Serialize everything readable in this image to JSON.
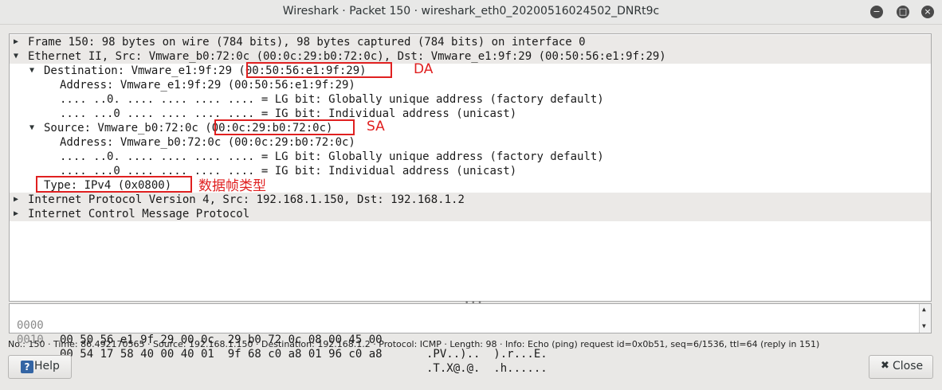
{
  "window": {
    "title": "Wireshark · Packet 150 · wireshark_eth0_20200516024502_DNRt9c",
    "minimize_glyph": "−",
    "maximize_glyph": "□",
    "close_glyph": "×"
  },
  "tree": {
    "rows": [
      {
        "arrow": "▶",
        "text": "Frame 150: 98 bytes on wire (784 bits), 98 bytes captured (784 bits) on interface 0"
      },
      {
        "arrow": "▼",
        "text": "Ethernet II, Src: Vmware_b0:72:0c (00:0c:29:b0:72:0c), Dst: Vmware_e1:9f:29 (00:50:56:e1:9f:29)"
      },
      {
        "arrow": "▼",
        "text": "Destination: Vmware_e1:9f:29 (00:50:56:e1:9f:29)"
      },
      {
        "arrow": "",
        "text": "Address: Vmware_e1:9f:29 (00:50:56:e1:9f:29)"
      },
      {
        "arrow": "",
        "text": ".... ..0. .... .... .... .... = LG bit: Globally unique address (factory default)"
      },
      {
        "arrow": "",
        "text": ".... ...0 .... .... .... .... = IG bit: Individual address (unicast)"
      },
      {
        "arrow": "▼",
        "text": "Source: Vmware_b0:72:0c (00:0c:29:b0:72:0c)"
      },
      {
        "arrow": "",
        "text": "Address: Vmware_b0:72:0c (00:0c:29:b0:72:0c)"
      },
      {
        "arrow": "",
        "text": ".... ..0. .... .... .... .... = LG bit: Globally unique address (factory default)"
      },
      {
        "arrow": "",
        "text": ".... ...0 .... .... .... .... = IG bit: Individual address (unicast)"
      },
      {
        "arrow": "",
        "text": "Type: IPv4 (0x0800)"
      },
      {
        "arrow": "▶",
        "text": "Internet Protocol Version 4, Src: 192.168.1.150, Dst: 192.168.1.2"
      },
      {
        "arrow": "▶",
        "text": "Internet Control Message Protocol"
      }
    ]
  },
  "annotations": {
    "da_label": "DA",
    "sa_label": "SA",
    "type_label": "数据帧类型",
    "color": "#e02020"
  },
  "hex": {
    "lines": [
      {
        "offset": "0000",
        "bytes": "00 50 56 e1 9f 29 00 0c  29 b0 72 0c 08 00 45 00",
        "ascii": ".PV..)..  ).r...E."
      },
      {
        "offset": "0010",
        "bytes": "00 54 17 58 40 00 40 01  9f 68 c0 a8 01 96 c0 a8",
        "ascii": ".T.X@.@.  .h......"
      }
    ],
    "scroll_up": "▲",
    "scroll_down": "▼"
  },
  "status": {
    "text": "No.: 150 · Time: 86.492170565 · Source: 192.168.1.150 · Destination: 192.168.1.2 · Protocol: ICMP · Length: 98 · Info: Echo (ping) request id=0x0b51, seq=6/1536, ttl=64 (reply in 151)"
  },
  "buttons": {
    "help_label": "Help",
    "help_icon_glyph": "?",
    "close_label": "Close",
    "close_icon_glyph": "✖"
  }
}
